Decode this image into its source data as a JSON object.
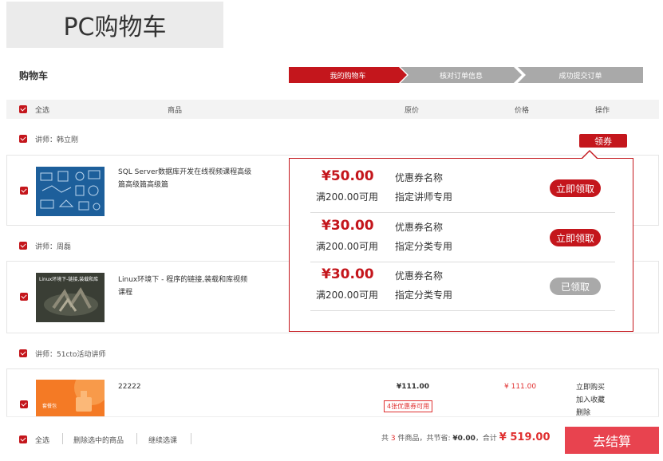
{
  "page_title": "PC购物车",
  "cart_title": "购物车",
  "steps": [
    "我的购物车",
    "核对订单信息",
    "成功提交订单"
  ],
  "table_header": {
    "select_all": "全选",
    "product": "商品",
    "original_price": "原价",
    "price": "价格",
    "operation": "操作"
  },
  "groups": [
    {
      "teacher": "讲师：韩立刚",
      "product_title": "SQL Server数据库开发在线视频课程高级篇高级篇高级篇",
      "thumb_icon": "database-course-thumbnail"
    },
    {
      "teacher": "讲师：周磊",
      "product_title": "Linux环境下 - 程序的链接,装载和库视频课程",
      "thumb_caption": "Linux环境下-链接,装载和库",
      "thumb_icon": "linux-course-thumbnail"
    },
    {
      "teacher": "讲师：51cto活动讲师",
      "product_title": "22222",
      "thumb_caption": "套餐包",
      "thumb_icon": "package-thumbnail",
      "original_price": "¥111.00",
      "price": "¥ 111.00",
      "coupon_tag": "4张优惠券可用",
      "ops": [
        "立即购买",
        "加入收藏",
        "删除"
      ]
    }
  ],
  "coupon_button": "领券",
  "coupons": [
    {
      "amount": "¥50.00",
      "condition": "满200.00可用",
      "name": "优惠券名称",
      "usage": "指定讲师专用",
      "button": "立即领取",
      "state": "available"
    },
    {
      "amount": "¥30.00",
      "condition": "满200.00可用",
      "name": "优惠券名称",
      "usage": "指定分类专用",
      "button": "立即领取",
      "state": "available"
    },
    {
      "amount": "¥30.00",
      "condition": "满200.00可用",
      "name": "优惠券名称",
      "usage": "指定分类专用",
      "button": "已领取",
      "state": "claimed"
    }
  ],
  "footer": {
    "select_all": "全选",
    "delete_selected": "删除选中的商品",
    "continue": "继续选课",
    "summary_prefix": "共",
    "count": "3",
    "summary_mid": "件商品，共节省:",
    "saved": "¥0.00",
    "total_label": "，合计",
    "total": "¥ 519.00",
    "checkout": "去结算"
  },
  "colors": {
    "accent": "#c4161c",
    "step_inactive": "#a9a9a9",
    "checkout": "#e8434f",
    "price": "#e03030"
  }
}
